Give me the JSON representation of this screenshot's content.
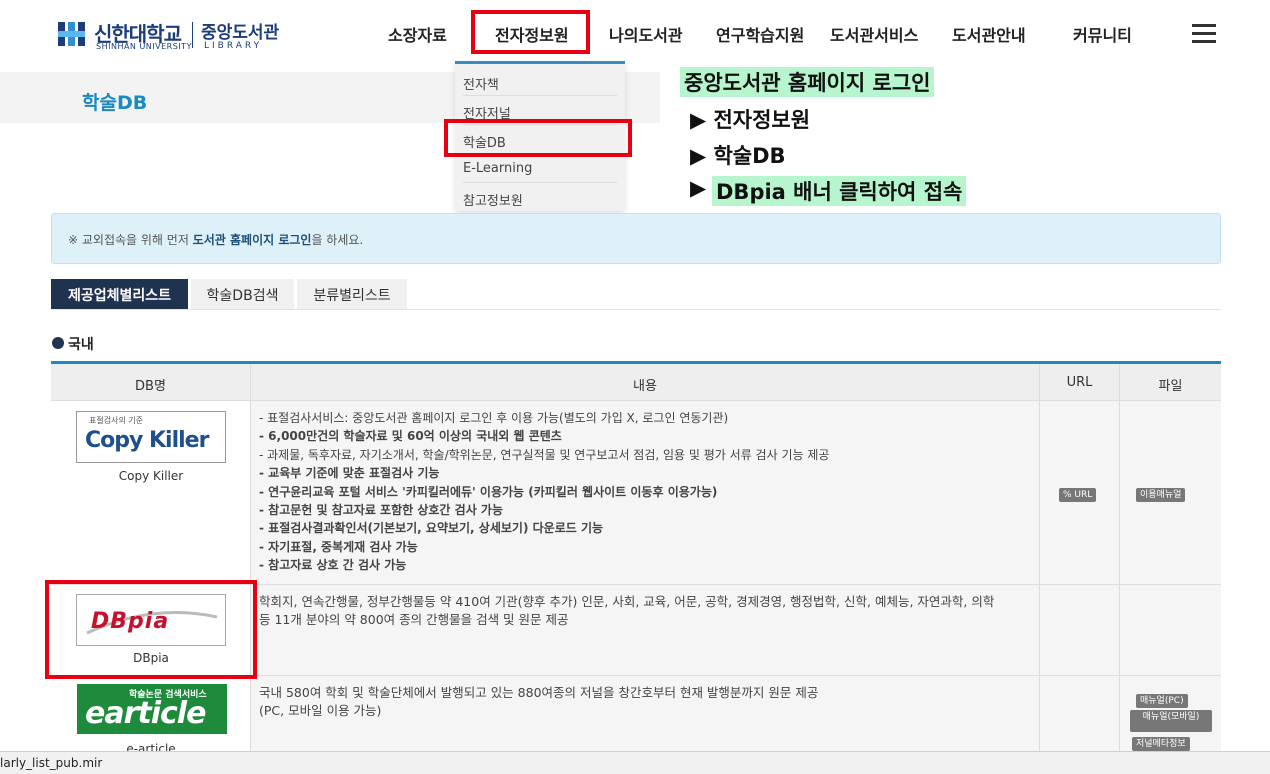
{
  "header": {
    "logo_ko": "신한대학교",
    "logo_en": "SHINHAN UNIVERSITY",
    "logo_lib_ko": "중앙도서관",
    "logo_lib_en": "LIBRARY",
    "nav": [
      "소장자료",
      "전자정보원",
      "나의도서관",
      "연구학습지원",
      "도서관서비스",
      "도서관안내",
      "커뮤니티"
    ]
  },
  "dropdown": [
    "전자책",
    "전자저널",
    "학술DB",
    "E-Learning",
    "참고정보원"
  ],
  "page_title": "학술DB",
  "annotation": {
    "line1": "중앙도서관 홈페이지 로그인",
    "line2": "▶ 전자정보원",
    "line3": "▶ 학술DB",
    "line4_arrow": "▶",
    "line4": "DBpia 배너 클릭하여 접속"
  },
  "notice": {
    "prefix": "※ 교외접속을 위해 먼저 ",
    "bold": "도서관 홈페이지 로그인",
    "suffix": "을 하세요."
  },
  "tabs": [
    "제공업체별리스트",
    "학술DB검색",
    "분류별리스트"
  ],
  "section_title": "국내",
  "table": {
    "headers": [
      "DB명",
      "내용",
      "URL",
      "파일"
    ],
    "rows": [
      {
        "logo_top": "표절검사의 기준",
        "logo_main": "Copy Killer",
        "name": "Copy Killer",
        "lines": [
          "- 표절검사서비스: 중앙도서관 홈페이지 로그인 후 이용 가능(별도의 가입 X, 로그인 연동기관)",
          "- 6,000만건의 학술자료 및 60억 이상의 국내외 웹 콘텐츠",
          "- 과제물, 독후자료, 자기소개서, 학술/학위논문, 연구실적물 및 연구보고서 점검, 임용 및 평가 서류 검사 기능 제공",
          "- 교육부 기준에 맞춘 표절검사 기능",
          "- 연구윤리교육 포털 서비스 '카피킬러에듀' 이용가능 (카피킬러 웹사이트 이동후 이용가능)",
          "- 참고문헌 및 참고자료 포함한 상호간 검사 가능",
          "- 표절검사결과확인서(기본보기, 요약보기, 상세보기) 다운로드 기능",
          "- 자기표절, 중복게재 검사 가능",
          "- 참고자료 상호 간 검사 가능"
        ],
        "url_badge": "% URL",
        "file_badges": [
          "이용매뉴얼"
        ]
      },
      {
        "logo_main": "DBpia",
        "name": "DBpia",
        "lines": [
          "학회지, 연속간행물, 정부간행물등 약 410여 기관(향후 추가) 인문, 사회, 교육, 어문, 공학, 경제경영, 행정법학, 신학, 예체능, 자연과학, 의학",
          "등 11개 분야의 약 800여 종의 간행물을 검색 및 원문 제공"
        ],
        "url_badge": "",
        "file_badges": []
      },
      {
        "logo_top": "학술논문 검색서비스",
        "logo_main": "earticle",
        "name": "e-article",
        "lines": [
          "국내 580여 학회 및 학술단체에서 발행되고 있는 880여종의 저널을 창간호부터 현재 발행분까지 원문 제공",
          "(PC, 모바일 이용 가능)"
        ],
        "url_badge": "",
        "file_badges": [
          "매뉴얼(PC)",
          "매뉴얼(모바일)",
          "저널메타정보"
        ]
      }
    ]
  },
  "status_bar": "larly_list_pub.mir",
  "colors": {
    "accent": "#1a8ac2",
    "highlight": "#e60012",
    "navy": "#1f3250",
    "annot_bg": "#b7f5cf"
  }
}
